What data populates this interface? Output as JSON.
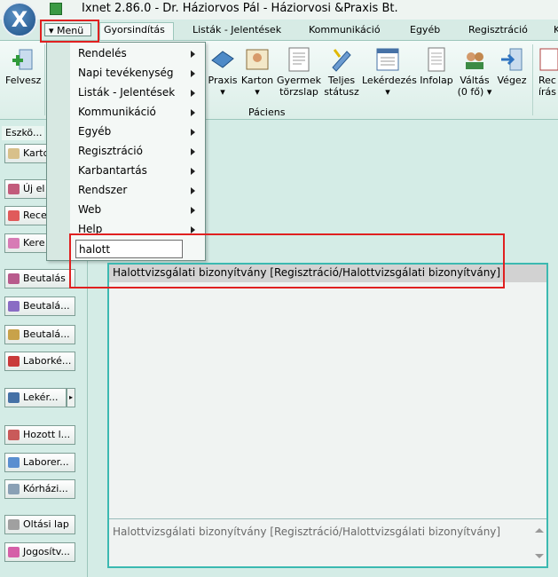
{
  "window": {
    "title": "Ixnet 2.86.0 - Dr. Háziorvos Pál - Háziorvosi &Praxis Bt."
  },
  "menu_button": {
    "label": "▾ Menü"
  },
  "tabs": [
    {
      "label": "Gyorsindítás",
      "active": true
    },
    {
      "label": "Listák - Jelentések"
    },
    {
      "label": "Kommunikáció"
    },
    {
      "label": "Egyéb"
    },
    {
      "label": "Regisztráció"
    },
    {
      "label": "K"
    }
  ],
  "ribbon": {
    "felvesz": "Felvesz",
    "buttons": [
      {
        "label": "Praxis",
        "arrow": "▾"
      },
      {
        "label": "Karton",
        "arrow": "▾"
      },
      {
        "label": "Gyermek\ntörzslap"
      },
      {
        "label": "Teljes\nstátusz"
      },
      {
        "label": "Lekérdezés",
        "arrow": "▾"
      },
      {
        "label": "Infolap"
      },
      {
        "label": "Váltás\n(0 fő)",
        "arrow": "▾"
      },
      {
        "label": "Végez"
      },
      {
        "label": "Rec\nírás"
      }
    ],
    "group_label": "Páciens"
  },
  "left_panel": {
    "header": "Eszkö...",
    "buttons": [
      "Kartc",
      "Új el",
      "Rece",
      "Kere",
      "Beutalás",
      "Beutalá...",
      "Beutalá...",
      "Laborké...",
      "Lekér...",
      "Hozott l...",
      "Laborer...",
      "Kórházi...",
      "Oltási lap",
      "Jogosítv..."
    ]
  },
  "dropdown": {
    "items": [
      "Rendelés",
      "Napi tevékenység",
      "Listák - Jelentések",
      "Kommunikáció",
      "Egyéb",
      "Regisztráció",
      "Karbantartás",
      "Rendszer",
      "Web",
      "Help"
    ],
    "search_value": "halott"
  },
  "results": {
    "item": "Halottvizsgálati bizonyítvány [Regisztráció/Halottvizsgálati bizonyítvány]",
    "detail": "Halottvizsgálati bizonyítvány [Regisztráció/Halottvizsgálati bizonyítvány]"
  },
  "colors": {
    "highlight": "#e02020",
    "accent": "#3bb9b1",
    "background": "#d4ece6"
  }
}
